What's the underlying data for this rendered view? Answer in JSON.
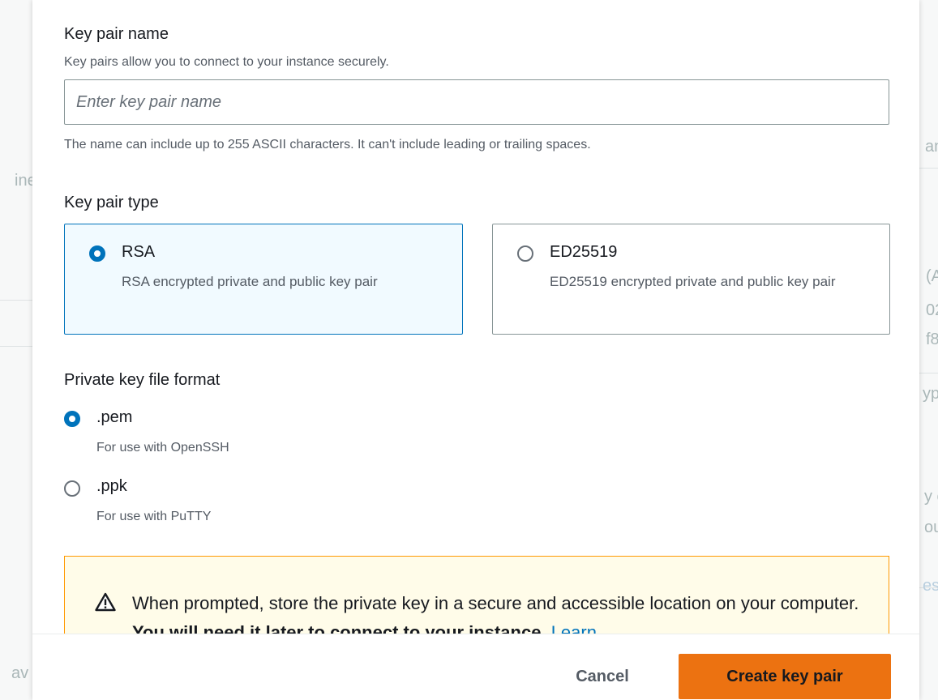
{
  "background": {
    "fragments": [
      "ine",
      "an",
      "(A",
      "02",
      "f8",
      "ype",
      "y c",
      "ou",
      "es",
      "av"
    ]
  },
  "modal": {
    "key_pair_name": {
      "label": "Key pair name",
      "description": "Key pairs allow you to connect to your instance securely.",
      "placeholder": "Enter key pair name",
      "value": "",
      "constraint": "The name can include up to 255 ASCII characters. It can't include leading or trailing spaces."
    },
    "key_pair_type": {
      "label": "Key pair type",
      "options": [
        {
          "title": "RSA",
          "description": "RSA encrypted private and public key pair",
          "selected": true
        },
        {
          "title": "ED25519",
          "description": "ED25519 encrypted private and public key pair",
          "selected": false
        }
      ]
    },
    "file_format": {
      "label": "Private key file format",
      "options": [
        {
          "title": ".pem",
          "description": "For use with OpenSSH",
          "selected": true
        },
        {
          "title": ".ppk",
          "description": "For use with PuTTY",
          "selected": false
        }
      ]
    },
    "alert": {
      "icon": "warning-icon",
      "text": "When prompted, store the private key in a secure and accessible location on your computer.",
      "bold_text": "You will need it later to connect to your instance.",
      "link_text": "Learn"
    },
    "footer": {
      "cancel_label": "Cancel",
      "create_label": "Create key pair"
    }
  },
  "colors": {
    "accent": "#0073bb",
    "primary_button": "#ec7211",
    "warning_border": "#ff9900",
    "warning_bg": "#fffce9"
  }
}
